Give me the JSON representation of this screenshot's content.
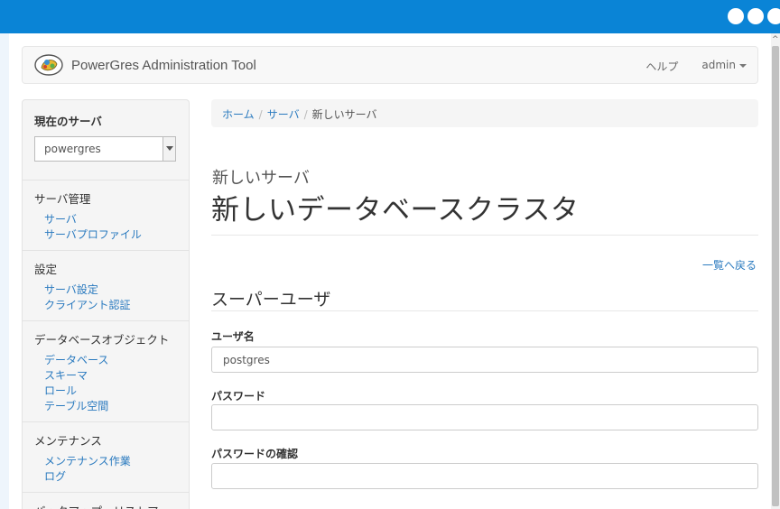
{
  "navbar": {
    "brand": "PowerGres Administration Tool",
    "help": "ヘルプ",
    "user": "admin"
  },
  "sidebar": {
    "current_server_heading": "現在のサーバ",
    "current_server_value": "powergres",
    "sections": [
      {
        "heading": "サーバ管理",
        "items": [
          "サーバ",
          "サーバプロファイル"
        ]
      },
      {
        "heading": "設定",
        "items": [
          "サーバ設定",
          "クライアント認証"
        ]
      },
      {
        "heading": "データベースオブジェクト",
        "items": [
          "データベース",
          "スキーマ",
          "ロール",
          "テーブル空間"
        ]
      },
      {
        "heading": "メンテナンス",
        "items": [
          "メンテナンス作業",
          "ログ"
        ]
      },
      {
        "heading": "バックアップ・リストア",
        "items": []
      }
    ]
  },
  "breadcrumb": {
    "home": "ホーム",
    "server": "サーバ",
    "current": "新しいサーバ"
  },
  "page": {
    "subtitle": "新しいサーバ",
    "title": "新しいデータベースクラスタ",
    "back_link": "一覧へ戻る",
    "section_title": "スーパーユーザ"
  },
  "form": {
    "username_label": "ユーザ名",
    "username_value": "postgres",
    "password_label": "パスワード",
    "password_value": "",
    "confirm_label": "パスワードの確認",
    "confirm_value": ""
  },
  "colors": {
    "titlebar": "#0a84d6",
    "link": "#2a7abf"
  }
}
